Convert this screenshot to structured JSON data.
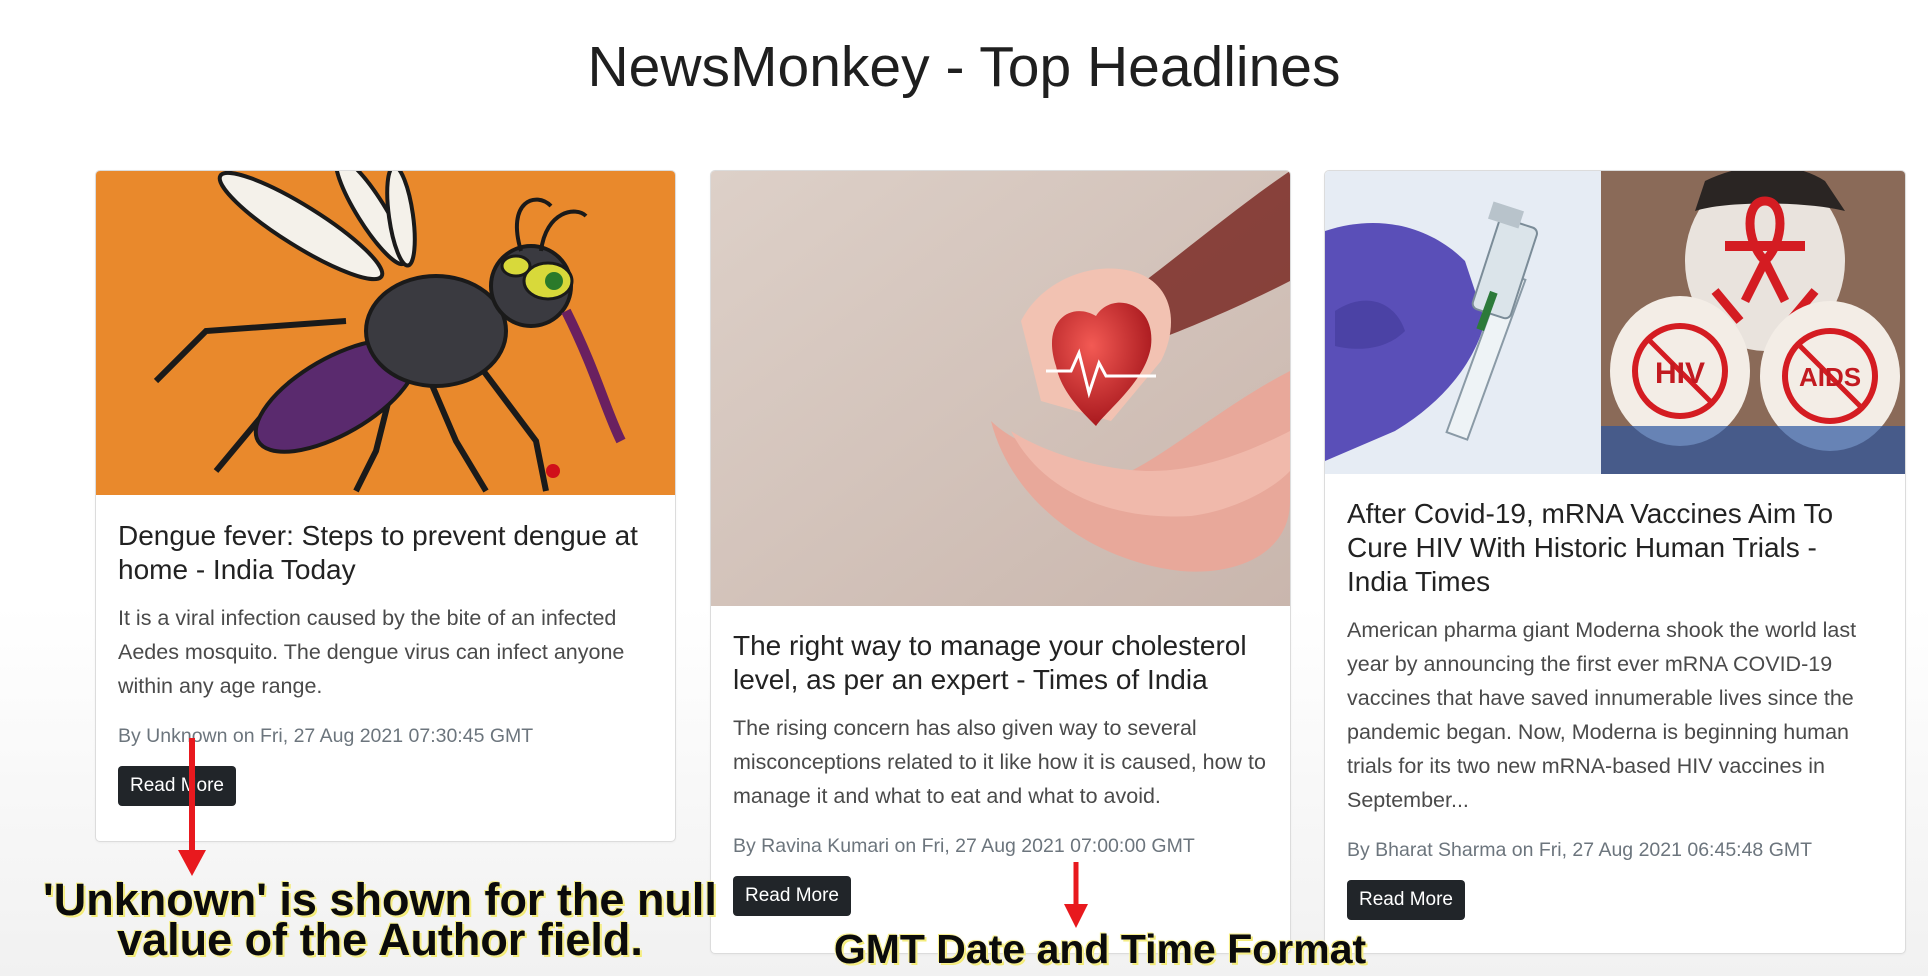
{
  "page": {
    "title": "NewsMonkey - Top Headlines"
  },
  "cards": [
    {
      "title": "Dengue fever: Steps to prevent dengue at home - India Today",
      "description": "It is a viral infection caused by the bite of an infected Aedes mosquito. The dengue virus can infect anyone within any age range.",
      "meta": "By Unknown on Fri, 27 Aug 2021 07:30:45 GMT",
      "button": "Read More",
      "image_icon": "mosquito-illustration"
    },
    {
      "title": "The right way to manage your cholesterol level, as per an expert - Times of India",
      "description": "The rising concern has also given way to several misconceptions related to it like how it is caused, how to manage it and what to eat and what to avoid.",
      "meta": "By Ravina Kumari on Fri, 27 Aug 2021 07:00:00 GMT",
      "button": "Read More",
      "image_icon": "hands-holding-heart"
    },
    {
      "title": "After Covid-19, mRNA Vaccines Aim To Cure HIV With Historic Human Trials - India Times",
      "description": "American pharma giant Moderna shook the world last year by announcing the first ever mRNA COVID-19 vaccines that have saved innumerable lives since the pandemic began. Now, Moderna is beginning human trials for its two new mRNA-based HIV vaccines in September...",
      "meta": "By Bharat Sharma on Fri, 27 Aug 2021 06:45:48 GMT",
      "button": "Read More",
      "image_icon": "vaccine-and-hiv-awareness",
      "image_text_left": "HIV",
      "image_text_right": "AIDS"
    }
  ],
  "annotations": {
    "author_note_line1": "'Unknown' is shown for the null",
    "author_note_line2": "value of the Author field.",
    "date_note": "GMT Date and Time Format"
  },
  "colors": {
    "arrow": "#e8191e",
    "button": "#212529",
    "highlight": "#f3ea6a"
  }
}
